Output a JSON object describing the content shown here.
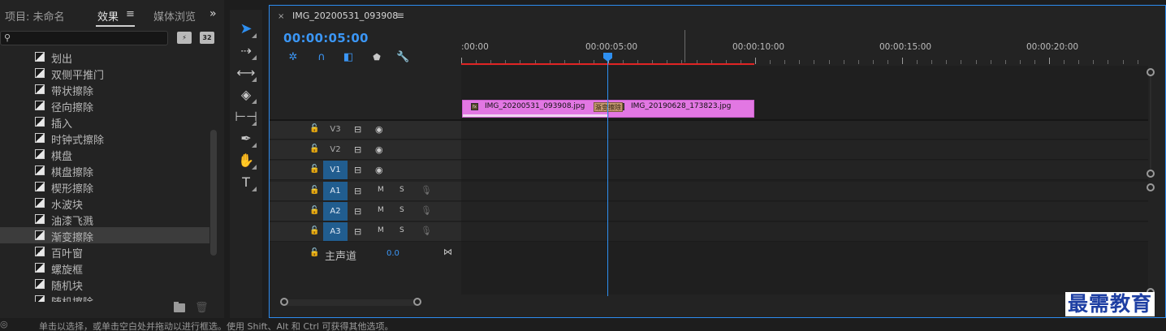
{
  "left_panel": {
    "tabs": {
      "project": "项目: 未命名",
      "effects": "效果",
      "effects_menu": "≡",
      "media": "媒体浏览器",
      "more": "»"
    },
    "search": {
      "placeholder": "",
      "value": "",
      "filter_accel": "⚡",
      "filter_32": "32"
    },
    "effects_items": [
      {
        "label": "划出"
      },
      {
        "label": "双侧平推门"
      },
      {
        "label": "带状擦除"
      },
      {
        "label": "径向擦除"
      },
      {
        "label": "插入"
      },
      {
        "label": "时钟式擦除"
      },
      {
        "label": "棋盘"
      },
      {
        "label": "棋盘擦除"
      },
      {
        "label": "楔形擦除"
      },
      {
        "label": "水波块"
      },
      {
        "label": "油漆飞溅"
      },
      {
        "label": "渐变擦除",
        "selected": true
      },
      {
        "label": "百叶窗"
      },
      {
        "label": "螺旋框"
      },
      {
        "label": "随机块"
      },
      {
        "label": "随机擦除"
      }
    ]
  },
  "tools": [
    {
      "name": "selection-tool",
      "glyph": "➤"
    },
    {
      "name": "track-select-tool",
      "glyph": "⇢"
    },
    {
      "name": "ripple-edit-tool",
      "glyph": "⟷"
    },
    {
      "name": "razor-tool",
      "glyph": "◈"
    },
    {
      "name": "slip-tool",
      "glyph": "⊢⊣"
    },
    {
      "name": "pen-tool",
      "glyph": "✒"
    },
    {
      "name": "hand-tool",
      "glyph": "✋"
    },
    {
      "name": "type-tool",
      "glyph": "T"
    }
  ],
  "timeline": {
    "sequence_tab": {
      "close": "×",
      "name": "IMG_20200531_093908",
      "menu": "≡"
    },
    "timecode": "00:00:05:00",
    "toolbar_icons": {
      "ripple": "✲",
      "snap": "∩",
      "linked": "◧",
      "marker": "⬟",
      "wrench": "🔧"
    },
    "ruler_labels": [
      ":00:00",
      "00:00:05:00",
      "00:00:10:00",
      "00:00:15:00",
      "00:00:20:00"
    ],
    "tracks": [
      {
        "name": "V3",
        "type": "video",
        "target": false
      },
      {
        "name": "V2",
        "type": "video",
        "target": false
      },
      {
        "name": "V1",
        "type": "video",
        "target": true
      },
      {
        "name": "A1",
        "type": "audio",
        "target": true,
        "mute": "M",
        "solo": "S"
      },
      {
        "name": "A2",
        "type": "audio",
        "target": true,
        "mute": "M",
        "solo": "S"
      },
      {
        "name": "A3",
        "type": "audio",
        "target": true,
        "mute": "M",
        "solo": "S"
      }
    ],
    "master": {
      "label": "主声道",
      "value": "0.0"
    },
    "clips": [
      {
        "name": "IMG_20200531_093908.jpg",
        "fx": "fx"
      },
      {
        "name": "IMG_20190628_173823.jpg",
        "fx": "fx"
      }
    ],
    "transition": "渐变擦除"
  },
  "status_bar": {
    "text": "单击以选择，或单击空白处并拖动以进行框选。使用 Shift、Alt 和 Ctrl 可获得其他选项。"
  },
  "watermark": "最需教育",
  "colors": {
    "accent": "#2e8ff0",
    "clip": "#e277e3",
    "work_bar": "#e02424",
    "target_track": "#215d8f"
  }
}
